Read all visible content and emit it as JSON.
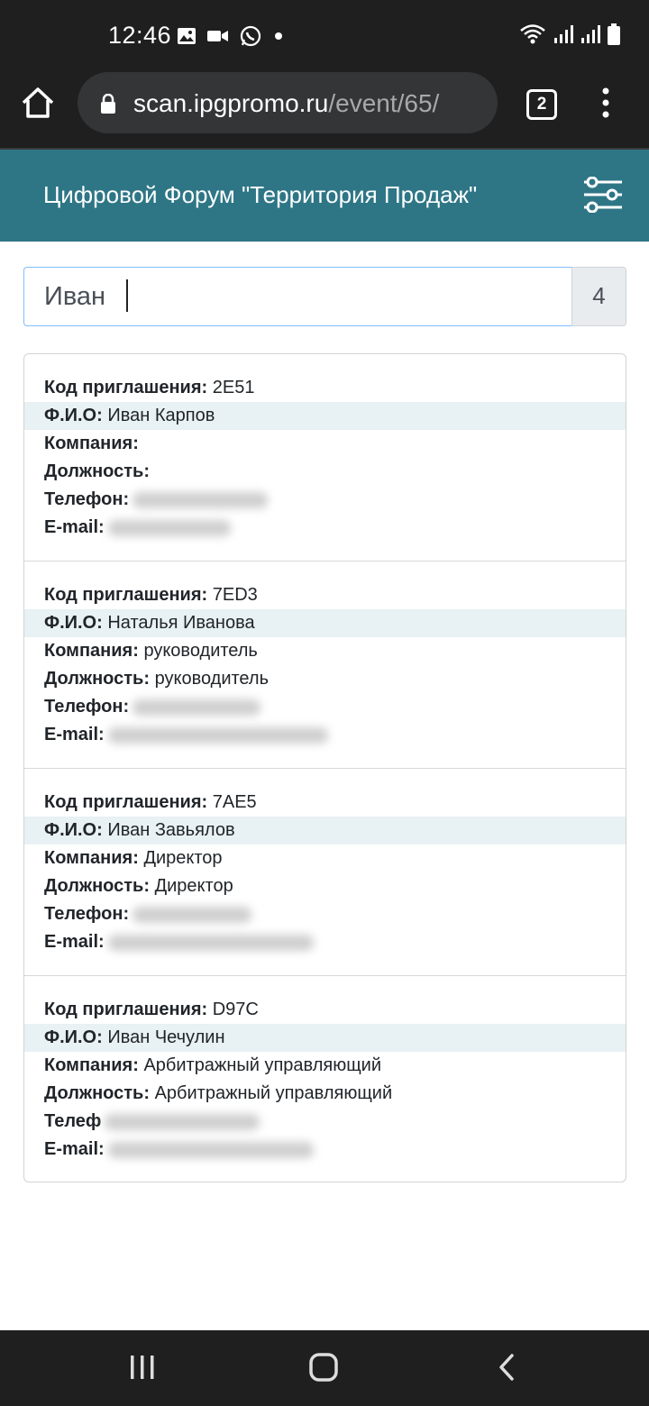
{
  "status_bar": {
    "time": "12:46",
    "icons_left": [
      "image-icon",
      "video-icon",
      "whatsapp-icon",
      "dot-icon"
    ],
    "icons_right": [
      "wifi-icon",
      "signal-icon",
      "signal-icon",
      "battery-icon"
    ]
  },
  "browser": {
    "url_host": "scan.ipgpromo.ru",
    "url_path": "/event/65/",
    "tab_count": "2"
  },
  "header": {
    "title": "Цифровой Форум \"Территория Продаж\""
  },
  "search": {
    "value": "Иван",
    "count": "4"
  },
  "labels": {
    "code": "Код приглашения:",
    "name": "Ф.И.О:",
    "company": "Компания:",
    "position": "Должность:",
    "phone": "Телефон:",
    "phone_partial": "Телеф",
    "email": "E-mail:"
  },
  "results": [
    {
      "code": "2E51",
      "name": "Иван Карпов",
      "company": "",
      "position": ""
    },
    {
      "code": "7ED3",
      "name": "Наталья Иванова",
      "company": "руководитель",
      "position": "руководитель"
    },
    {
      "code": "7AE5",
      "name": "Иван Завьялов",
      "company": "Директор",
      "position": "Директор"
    },
    {
      "code": "D97C",
      "name": "Иван Чечулин",
      "company": "Арбитражный управляющий",
      "position": "Арбитражный управляющий"
    }
  ],
  "colors": {
    "header_bg": "#2e7686",
    "system_bar_bg": "#1f1f1f",
    "row_highlight": "#e8f1f3"
  }
}
